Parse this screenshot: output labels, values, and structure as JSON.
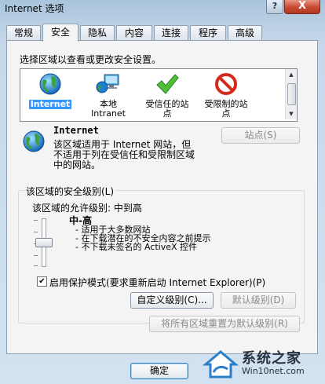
{
  "window": {
    "title": "Internet 选项",
    "help_label": "?",
    "close_label": "X"
  },
  "tabs": [
    "常规",
    "安全",
    "隐私",
    "内容",
    "连接",
    "程序",
    "高级"
  ],
  "active_tab": "安全",
  "zones": {
    "prompt": "选择区域以查看或更改安全设置。",
    "items": [
      {
        "label": "Internet",
        "icon": "globe-icon",
        "selected": true
      },
      {
        "label": "本地\nIntranet",
        "icon": "intranet-icon",
        "selected": false
      },
      {
        "label": "受信任的站\n点",
        "icon": "checkmark-icon",
        "selected": false
      },
      {
        "label": "受限制的站\n点",
        "icon": "restricted-icon",
        "selected": false
      }
    ]
  },
  "info": {
    "title": "Internet",
    "description": "该区域适用于 Internet 网站，但\n不适用于列在受信任和受限制区域\n中的网站。",
    "sites_button": "站点(S)"
  },
  "security": {
    "group_label": "该区域的安全级别(L)",
    "allowed_levels": "该区域的允许级别: 中到高",
    "level_name": "中-高",
    "bullets": [
      "- 适用于大多数网站",
      "- 在下载潜在的不安全内容之前提示",
      "- 不下载未签名的 ActiveX 控件"
    ],
    "protected_mode_label": "启用保护模式(要求重新启动 Internet Explorer)(P)",
    "protected_mode_checked": true,
    "custom_level_button": "自定义级别(C)...",
    "default_level_button": "默认级别(D)",
    "reset_all_button": "将所有区域重置为默认级别(R)"
  },
  "footer": {
    "ok_button": "确定"
  },
  "watermark": {
    "title": "系统之家",
    "url": "Win10net.com"
  }
}
